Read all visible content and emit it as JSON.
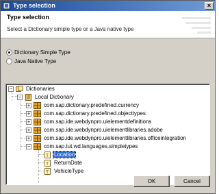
{
  "window": {
    "title": "Type selection"
  },
  "header": {
    "title": "Type selection",
    "description": "Select a Dictionary simple type or a Java native type"
  },
  "options": [
    {
      "label": "Dictionary Simple Type",
      "selected": true
    },
    {
      "label": "Java Native Type",
      "selected": false
    }
  ],
  "tree": {
    "root": "Dictionaries",
    "local": "Local Dictionary",
    "packages": [
      "com.sap.dictionary.predefined.currency",
      "com.sap.dictionary.predefined.objecttypes",
      "com.sap.ide.webdynpro.uielementdefinitions",
      "com.sap.ide.webdynpro.uielementlibraries.adobe",
      "com.sap.ide.webdynpro.uielementlibraries.officeintegration",
      "com.sap.tut.wd.languages.simpletypes"
    ],
    "types": [
      "Location",
      "ReturnDate",
      "VehicleType"
    ],
    "selected_type": "Location"
  },
  "buttons": {
    "ok": "OK",
    "cancel": "Cancel"
  },
  "colors": {
    "selection": "#316ac5",
    "titlebar": "#1a4a9a"
  }
}
